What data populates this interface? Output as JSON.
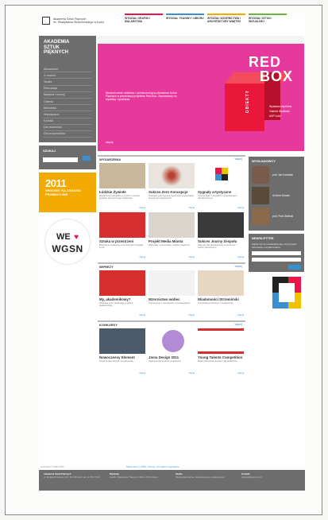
{
  "header": {
    "logo_text_1": "Akademia Sztuk Pięknych",
    "logo_text_2": "im. Władysława Strzemińskiego w Łodzi",
    "nav": [
      {
        "label": "WYDZIAŁ GRAFIKI I MALARSTWA",
        "color": "#e8164a"
      },
      {
        "label": "WYDZIAŁ TKANINY I UBIORU",
        "color": "#3a8fd0"
      },
      {
        "label": "WYDZIAŁ WZORNICTWA I ARCHITEKTURY WNĘTRZ",
        "color": "#f2a900"
      },
      {
        "label": "WYDZIAŁ SZTUKI WIZUALNEJ",
        "color": "#6bb43f"
      }
    ]
  },
  "sidebar": {
    "brand_line1": "AKADEMIA",
    "brand_line2": "SZTUK",
    "brand_line3": "PIĘKNYCH",
    "menu": [
      "Aktualności",
      "O uczelni",
      "Studia",
      "Rekrutacja",
      "Badania i rozwój",
      "Galeria",
      "Biblioteka",
      "Współpraca",
      "Kontakt",
      "Dla studentów",
      "Dla pracowników"
    ],
    "search_label": "SZUKAJ",
    "promo_year": "2011",
    "promo_text": "WNIOSEK NA ZADANIA PROMOCYJNE",
    "wgsn_we": "WE",
    "wgsn_heart": "♥",
    "wgsn_brand": "WGSN"
  },
  "hero": {
    "more": "więcej",
    "text": "Nieskończenie obiektów i przestrzeni łączy Akademia Sztuk Pięknych w prezentacji projektów Red-Box. Zapraszamy na wystawę i spotkania.",
    "title1": "RED",
    "title2": "BOX",
    "vertical": "OBIEKTY",
    "info1": "Wystawa objektów",
    "info2": "Galeria Wydziału",
    "info3": "ASP Łódź"
  },
  "sections": [
    {
      "title": "WYDARZENIA",
      "more": "więcej",
      "items": [
        {
          "title": "Łódzkie Żywiołe",
          "desc": "Wydarzenie kulturalne w Łodzi w ramach projektu artystycznego studentów.",
          "link": "więcej",
          "color": "#c9b79c"
        },
        {
          "title": "Sukces Zero Koncepcje",
          "desc": "Wystawa prac dyplomowych oraz prezentacja koncepcji projektowych.",
          "link": "więcej",
          "color": "#e9e4de"
        },
        {
          "title": "Sygnały artystyczne",
          "desc": "Cykl spotkań z artystami i projektantami współczesnymi.",
          "link": "więcej",
          "color": "#ffffff"
        },
        {
          "title": "Sztuka w przestrzeni",
          "desc": "Realizacje studentów w przestrzeni miejskiej Łodzi.",
          "link": "więcej",
          "color": "#d62d2d"
        },
        {
          "title": "Projekt Media Miasta",
          "desc": "Warsztaty i prezentacje mediów miejskich.",
          "link": "więcej",
          "color": "#d9d4cc"
        },
        {
          "title": "Sukces Journy Zespołu",
          "desc": "Nagrody dla absolwentów w konkursie międzynarodowym.",
          "link": "więcej",
          "color": "#3a3a3a"
        }
      ]
    },
    {
      "title": "IMPREZY",
      "more": "więcej",
      "items": [
        {
          "title": "My, akademikowy?",
          "desc": "Wystawa prac studentów w galerii akademickiej.",
          "link": "więcej",
          "color": "#d62d2d"
        },
        {
          "title": "Wzornictwo wobec",
          "desc": "Konferencja o wzornictwie i projektowaniu.",
          "link": "więcej",
          "color": "#f2f2f2"
        },
        {
          "title": "Wiadomości Strzemiński",
          "desc": "Prezentacja archiwum i wydawnictw.",
          "link": "więcej",
          "color": "#e7d7c2"
        }
      ]
    },
    {
      "title": "KONKURSY",
      "more": "więcej",
      "items": [
        {
          "title": "Nowoczesny Element",
          "desc": "Konkurs dla młodych projektantów.",
          "link": "więcej",
          "color": "#4a5a6a"
        },
        {
          "title": "Joma Design 2011",
          "desc": "Ogólnopolski konkurs projektowy.",
          "link": "więcej",
          "color": "#ffffff"
        },
        {
          "title": "Young Talents Competition",
          "desc": "Międzynarodowy konkurs dla studentów.",
          "link": "więcej",
          "color": "#ffffff"
        }
      ]
    }
  ],
  "right": {
    "people_title": "WYKŁADOWCY",
    "people": [
      "prof. Jan Kowalski",
      "dr Anna Nowak",
      "prof. Piotr Zieliński"
    ],
    "newsletter_title": "NEWSLETTER",
    "newsletter_text": "Zapisz się do newslettera aby otrzymywać informacje o wydarzeniach.",
    "newsletter_btn": "Wyślij"
  },
  "footer": {
    "copyright": "Copyright © ASP 2011",
    "links": "Mapa strony | RSS | Pomoc | Kontakt | Logowanie",
    "cols": [
      {
        "title": "Akademia Sztuk Pięknych",
        "text": "ul. Wojska Polskiego 121, 91-726 Łódź, tel. 42 254 75 00"
      },
      {
        "title": "Wydziały",
        "text": "Grafiki i Malarstwa, Tkaniny i Ubioru, Wzornictwa"
      },
      {
        "title": "Studia",
        "text": "Studia stacjonarne, niestacjonarne, podyplomowe"
      },
      {
        "title": "Kontakt",
        "text": "rektorat@asp.lodz.pl"
      }
    ]
  }
}
